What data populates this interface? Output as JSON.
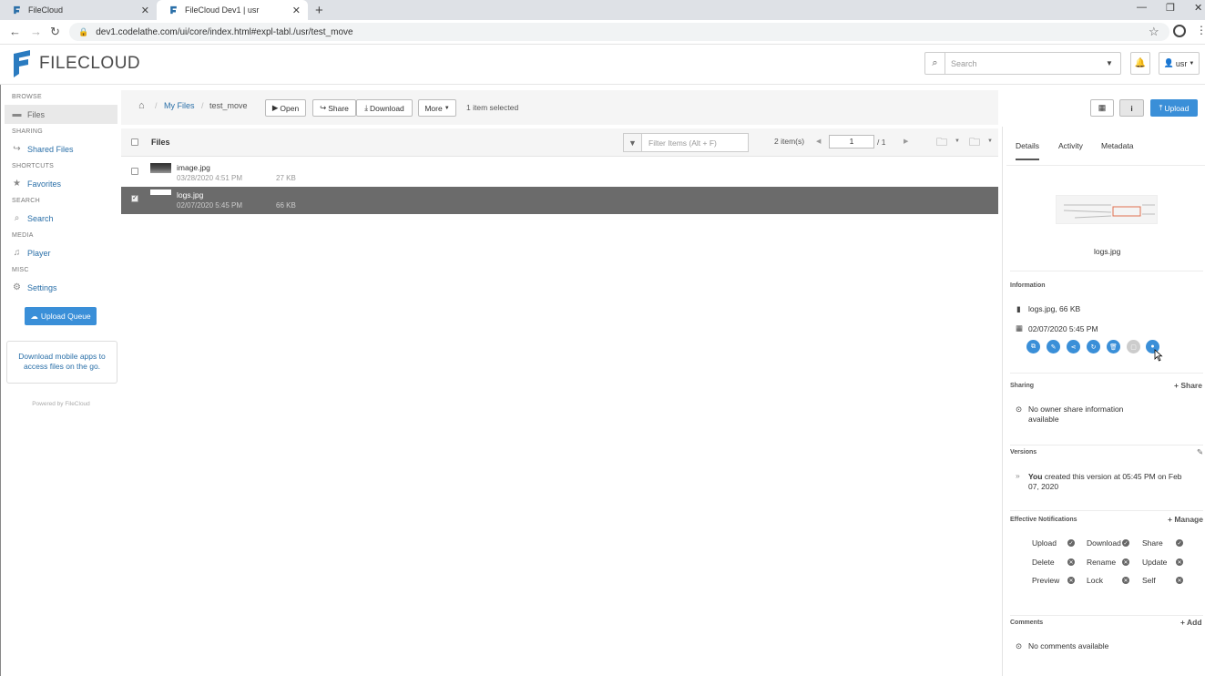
{
  "browser": {
    "tabs": [
      {
        "title": "FileCloud"
      },
      {
        "title": "FileCloud Dev1 | usr"
      }
    ],
    "url": "dev1.codelathe.com/ui/core/index.html#expl-tabl./usr/test_move"
  },
  "header": {
    "logo_text": "FILECLOUD",
    "search_placeholder": "Search",
    "user_label": "usr"
  },
  "sidebar": {
    "sections": {
      "browse": "BROWSE",
      "sharing": "SHARING",
      "shortcuts": "SHORTCUTS",
      "search": "SEARCH",
      "media": "MEDIA",
      "misc": "MISC"
    },
    "items": {
      "files": "Files",
      "shared_files": "Shared Files",
      "favorites": "Favorites",
      "search": "Search",
      "player": "Player",
      "settings": "Settings"
    },
    "upload_queue": "Upload Queue",
    "mobile_text": "Download mobile apps to access files on the go.",
    "powered_by": "Powered by FileCloud"
  },
  "toolbar": {
    "breadcrumb": [
      "My Files",
      "test_move"
    ],
    "open": "Open",
    "share": "Share",
    "download": "Download",
    "more": "More",
    "selection_text": "1 item selected",
    "upload": "Upload"
  },
  "file_list": {
    "header": "Files",
    "filter_placeholder": "Filter Items (Alt + F)",
    "item_count": "2 item(s)",
    "page": "1",
    "page_total": "/ 1",
    "rows": [
      {
        "name": "image.jpg",
        "date": "03/28/2020 4:51 PM",
        "size": "27 KB",
        "selected": false
      },
      {
        "name": "logs.jpg",
        "date": "02/07/2020 5:45 PM",
        "size": "66 KB",
        "selected": true
      }
    ]
  },
  "details": {
    "tabs": [
      "Details",
      "Activity",
      "Metadata"
    ],
    "preview_name": "logs.jpg",
    "information_label": "Information",
    "file_info": "logs.jpg, 66 KB",
    "file_date": "02/07/2020 5:45 PM",
    "sharing_label": "Sharing",
    "share_link": "Share",
    "no_share": "No owner share information available",
    "versions_label": "Versions",
    "version_bold": "You",
    "version_text": "created this version at 05:45 PM on Feb 07, 2020",
    "notifications_label": "Effective Notifications",
    "manage_link": "Manage",
    "notifications": [
      [
        "Upload",
        "Download",
        "Share"
      ],
      [
        "Delete",
        "Rename",
        "Update"
      ],
      [
        "Preview",
        "Lock",
        "Self"
      ]
    ],
    "comments_label": "Comments",
    "add_link": "Add",
    "no_comments": "No comments available"
  },
  "colors": {
    "accent": "#3a8fd8",
    "selected_row": "#6b6b6b",
    "link": "#2a6fa8"
  }
}
